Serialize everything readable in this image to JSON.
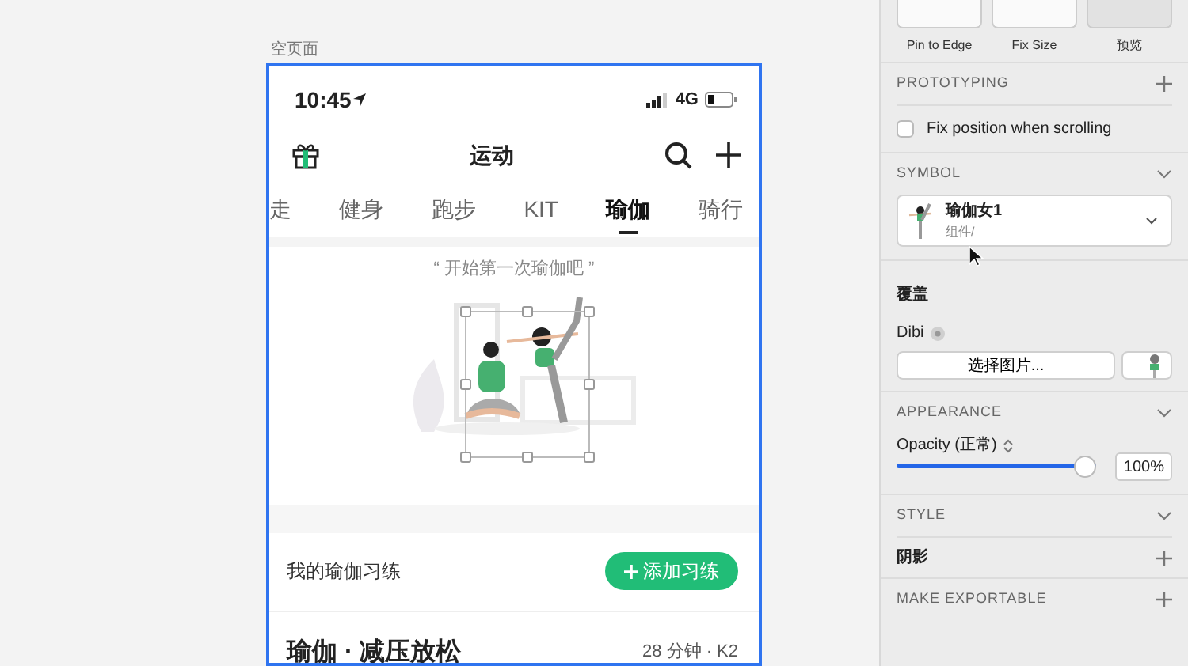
{
  "canvas": {
    "artboard_title": "空页面"
  },
  "phone": {
    "status_bar": {
      "time": "10:45",
      "network": "4G"
    },
    "nav": {
      "title": "运动"
    },
    "tabs": [
      {
        "label": "走",
        "selected": false
      },
      {
        "label": "健身",
        "selected": false
      },
      {
        "label": "跑步",
        "selected": false
      },
      {
        "label": "KIT",
        "selected": false
      },
      {
        "label": "瑜伽",
        "selected": true
      },
      {
        "label": "骑行",
        "selected": false
      }
    ],
    "empty_state": {
      "message": "“ 开始第一次瑜伽吧 ”"
    },
    "practice_section": {
      "title": "我的瑜伽习练",
      "add_button": "添加习练"
    },
    "course": {
      "title": "瑜伽 · 减压放松",
      "meta": "28 分钟 · K2"
    }
  },
  "inspector": {
    "resizing_labels": [
      "Pin to Edge",
      "Fix Size",
      "预览"
    ],
    "prototyping": {
      "title": "PROTOTYPING",
      "fix_position": {
        "label": "Fix position when scrolling",
        "checked": false
      }
    },
    "symbol": {
      "title": "SYMBOL",
      "name": "瑜伽女1",
      "path": "组件/"
    },
    "overrides": {
      "title": "覆盖",
      "layer": "Dibi",
      "choose_button": "选择图片..."
    },
    "appearance": {
      "title": "APPEARANCE",
      "opacity_label": "Opacity (正常)",
      "level": 1.0,
      "value": "100%"
    },
    "style": {
      "title": "STYLE",
      "shadow": "阴影"
    },
    "export": {
      "title": "MAKE EXPORTABLE"
    }
  }
}
